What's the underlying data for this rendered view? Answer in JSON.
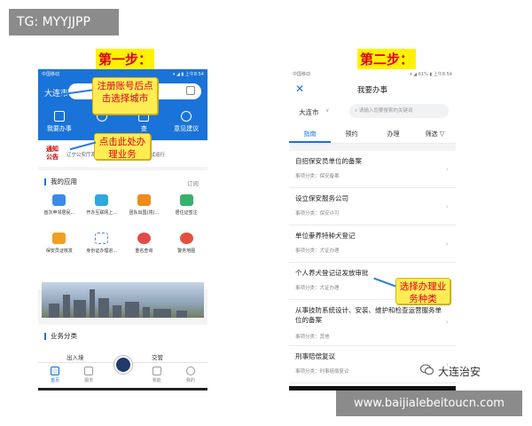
{
  "tg_badge": "TG: MYYJJPP",
  "step1": {
    "title": "第一步："
  },
  "step2": {
    "title": "第二步："
  },
  "phone1": {
    "status_left": "中国移动",
    "status_right": "▾ ◢ ▮ 上午8:54",
    "city": "大连市",
    "quick_actions": [
      {
        "label": "我要办事",
        "icon": "document-icon"
      },
      {
        "label": "",
        "icon": "chat-icon"
      },
      {
        "label": "查",
        "icon": "search-icon"
      },
      {
        "label": "意见建议",
        "icon": "person-icon"
      }
    ],
    "notice_badge": "通知公告",
    "notice_text": "辽宁公安厅系统DX0001X00000X0X 试运行",
    "my_apps_title": "我的应用",
    "my_apps_more": "订阅",
    "apps_row1": [
      "首次申领居民...",
      "开办互联网上...",
      "团队出国(境)...",
      "居住证签注"
    ],
    "apps_row2": [
      "保安员证核发",
      "身份证办理进...",
      "重名查询",
      "警务地图"
    ],
    "biz_title": "业务分类",
    "biz_items": [
      "出入境",
      "交管"
    ],
    "tabbar": [
      "首页",
      "服务",
      "",
      "我能",
      "我的"
    ]
  },
  "phone2": {
    "status_left": "中国移动",
    "status_right": "▾ ◢ 61% ▮ 上午8:54",
    "title": "我要办事",
    "city": "大连市",
    "search_placeholder": "请输入您要搜索的关键词",
    "tabs": [
      "指南",
      "预约",
      "办理",
      "筛选 ▽"
    ],
    "items": [
      {
        "name": "自招保安员单位的备案",
        "category": "事项分类：保安备案"
      },
      {
        "name": "设立保安服务公司",
        "category": "事项分类：保安许可"
      },
      {
        "name": "单位豢养特种犬登记",
        "category": "事项分类：犬证办理"
      },
      {
        "name": "个人养犬登记证发放审批",
        "category": "事项分类：犬证办理"
      },
      {
        "name": "从事技防系统设计、安装、维护和检查运营服务单位的备案",
        "category": "事项分类：其他"
      },
      {
        "name": "刑事赔偿复议",
        "category": "事项分类：刑事赔偿复议"
      }
    ]
  },
  "callouts": {
    "register": "注册账号后点击选择城市",
    "click_here": "点击此处办理业务",
    "select_type": "选择办理业务种类"
  },
  "watermark": "大连治安",
  "site_badge": "www.baijialebeitoucn.com",
  "colors": {
    "brand_blue": "#1a73d9",
    "callout_yellow": "#ffec55",
    "callout_red": "#d9001b",
    "step_yellow": "#fff200"
  }
}
